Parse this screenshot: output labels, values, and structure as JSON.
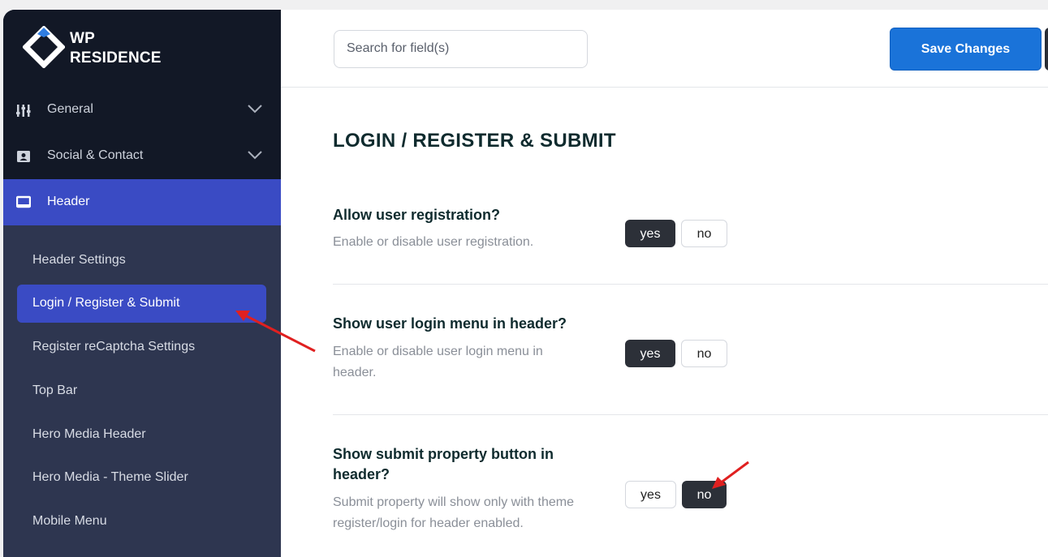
{
  "brand": {
    "line1": "WP",
    "line2": "RESIDENCE"
  },
  "sidebar": {
    "nav": [
      {
        "label": "General",
        "icon": "sliders-icon",
        "expandable": true
      },
      {
        "label": "Social & Contact",
        "icon": "contact-card-icon",
        "expandable": true
      },
      {
        "label": "Header",
        "icon": "monitor-icon",
        "expandable": false,
        "active": true
      }
    ],
    "subnav": [
      {
        "label": "Header Settings"
      },
      {
        "label": "Login / Register & Submit",
        "active": true
      },
      {
        "label": "Register reCaptcha Settings"
      },
      {
        "label": "Top Bar"
      },
      {
        "label": "Hero Media Header"
      },
      {
        "label": "Hero Media - Theme Slider"
      },
      {
        "label": "Mobile Menu"
      }
    ]
  },
  "topbar": {
    "search_placeholder": "Search for field(s)",
    "save_label": "Save Changes"
  },
  "main": {
    "title": "LOGIN / REGISTER & SUBMIT",
    "settings": [
      {
        "title": "Allow user registration?",
        "description": "Enable or disable user registration.",
        "yes_label": "yes",
        "no_label": "no",
        "selected": "yes"
      },
      {
        "title": "Show user login menu in header?",
        "description": "Enable or disable user login menu in header.",
        "yes_label": "yes",
        "no_label": "no",
        "selected": "yes"
      },
      {
        "title": "Show submit property button in header?",
        "description": "Submit property will show only with theme register/login for header enabled.",
        "yes_label": "yes",
        "no_label": "no",
        "selected": "no"
      }
    ]
  },
  "colors": {
    "sidebar_dark": "#121826",
    "sidebar": "#2e3650",
    "accent": "#3a4bc4",
    "save": "#1a73d9",
    "annotation": "#e02020"
  }
}
